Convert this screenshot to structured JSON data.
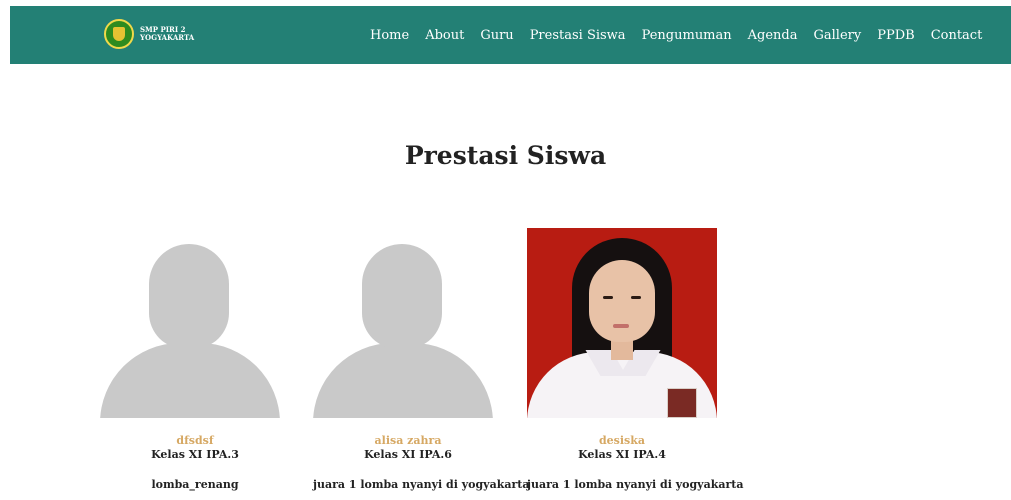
{
  "brand": {
    "line1": "SMP PIRI 2",
    "line2": "YOGYAKARTA"
  },
  "nav": {
    "items": [
      "Home",
      "About",
      "Guru",
      "Prestasi Siswa",
      "Pengumuman",
      "Agenda",
      "Gallery",
      "PPDB",
      "Contact"
    ]
  },
  "page": {
    "title": "Prestasi Siswa"
  },
  "cards": [
    {
      "name": "dfsdsf",
      "class": "Kelas XI IPA.3",
      "achievement": "lomba_renang",
      "photo": "placeholder-silhouette"
    },
    {
      "name": "alisa zahra",
      "class": "Kelas XI IPA.6",
      "achievement": "juara 1 lomba nyanyi di yogyakarta",
      "photo": "placeholder-silhouette"
    },
    {
      "name": "desiska",
      "class": "Kelas XI IPA.4",
      "achievement": "juara 1 lomba nyanyi di yogyakarta",
      "photo": "student-portrait"
    }
  ],
  "colors": {
    "navbar": "#238075",
    "name_accent": "#d6a863"
  }
}
